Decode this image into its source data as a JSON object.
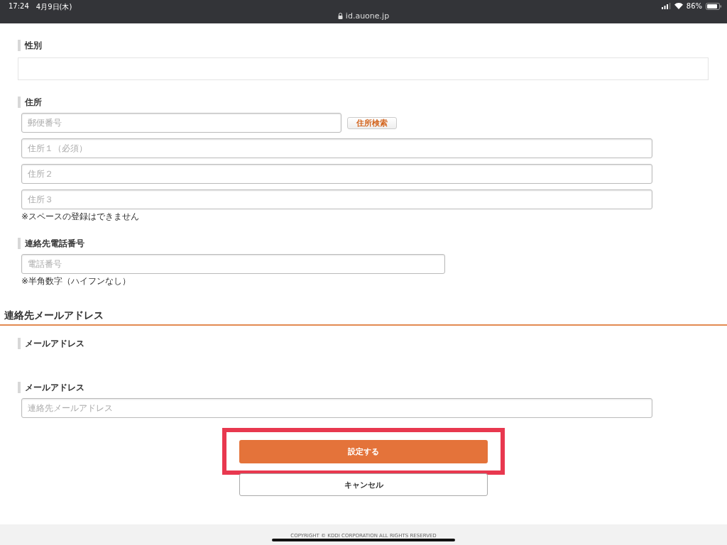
{
  "status_bar": {
    "time": "17:24",
    "date": "4月9日(木)",
    "url": "id.auone.jp",
    "battery": "86%"
  },
  "gender": {
    "label": "性別"
  },
  "address": {
    "label": "住所",
    "postal_placeholder": "郵便番号",
    "search_button": "住所検索",
    "fields": [
      {
        "placeholder": "住所１（必須）"
      },
      {
        "placeholder": "住所２"
      },
      {
        "placeholder": "住所３"
      }
    ],
    "note": "※スペースの登録はできません"
  },
  "phone": {
    "label": "連絡先電話番号",
    "placeholder": "電話番号",
    "note": "※半角数字（ハイフンなし）"
  },
  "email_section": {
    "heading": "連絡先メールアドレス",
    "current_label": "メールアドレス",
    "new_label": "メールアドレス",
    "placeholder": "連絡先メールアドレス"
  },
  "buttons": {
    "submit": "設定する",
    "cancel": "キャンセル"
  },
  "footer": {
    "copyright": "COPYRIGHT © KDDI CORPORATION ALL RIGHTS RESERVED"
  }
}
